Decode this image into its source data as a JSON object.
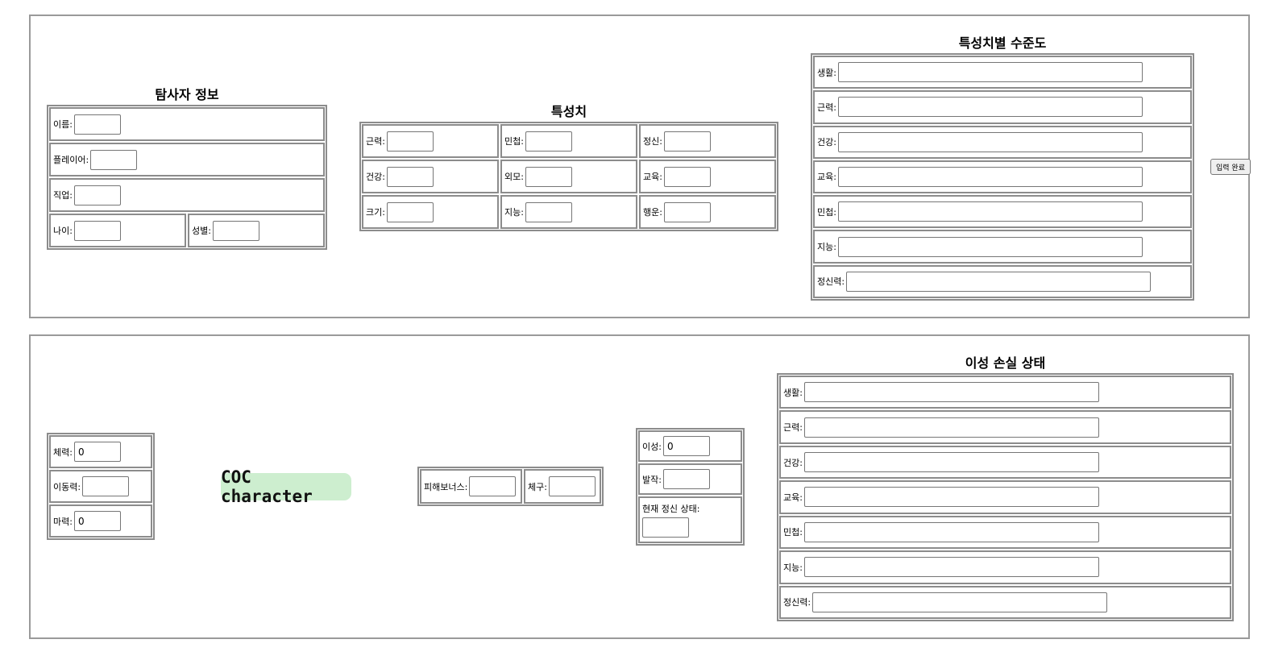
{
  "investigator": {
    "title": "탐사자 정보",
    "name_label": "이름:",
    "player_label": "플레이어:",
    "job_label": "직업:",
    "age_label": "나이:",
    "gender_label": "성별:"
  },
  "traits": {
    "title": "특성치",
    "strength_label": "근력:",
    "dexterity_label": "민첩:",
    "mind_label": "정신:",
    "health_label": "건강:",
    "appearance_label": "외모:",
    "education_label": "교육:",
    "size_label": "크기:",
    "intelligence_label": "지능:",
    "luck_label": "행운:"
  },
  "trait_levels": {
    "title": "특성치별 수준도",
    "items": [
      "생활:",
      "근력:",
      "건강:",
      "교육:",
      "민첩:",
      "지능:",
      "정신력:"
    ]
  },
  "submit_label": "입력 완료",
  "stats": {
    "hp_label": "체력:",
    "hp_value": "0",
    "move_label": "이동력:",
    "move_value": "",
    "magic_label": "마력:",
    "magic_value": "0"
  },
  "app_title": "COC character",
  "combat": {
    "damage_bonus_label": "피해보너스:",
    "build_label": "체구:"
  },
  "sanity": {
    "sanity_label": "이성:",
    "sanity_value": "0",
    "fit_label": "발작:",
    "current_state_label": "현재 정신 상태:"
  },
  "sanity_loss": {
    "title": "이성 손실 상태",
    "items": [
      "생활:",
      "근력:",
      "건강:",
      "교육:",
      "민첩:",
      "지능:",
      "정신력:"
    ]
  }
}
